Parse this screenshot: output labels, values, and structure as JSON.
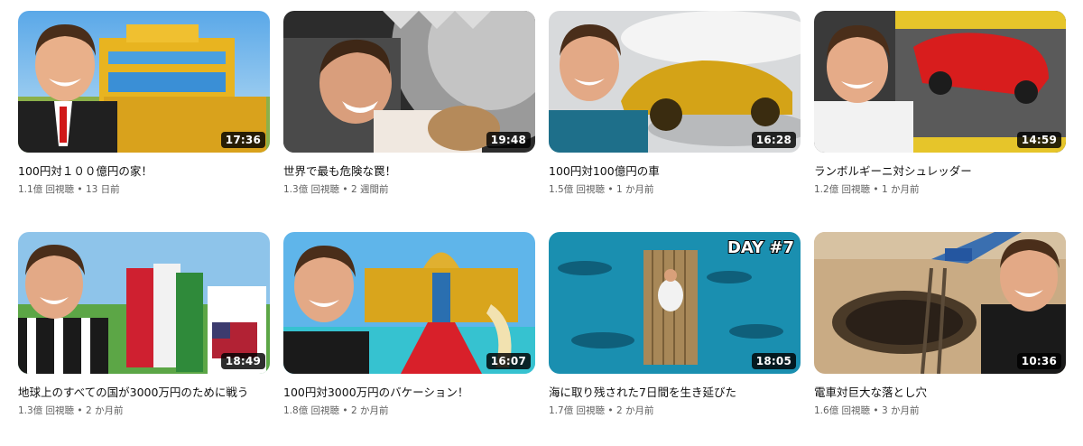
{
  "videos": [
    {
      "title": "100円対１００億円の家！",
      "views": "1.1億 回視聴",
      "age": "13 日前",
      "duration": "17:36"
    },
    {
      "title": "世界で最も危険な罠！",
      "views": "1.3億 回視聴",
      "age": "2 週間前",
      "duration": "19:48"
    },
    {
      "title": "100円対100億円の車",
      "views": "1.5億 回視聴",
      "age": "1 か月前",
      "duration": "16:28"
    },
    {
      "title": "ランボルギーニ対シュレッダー",
      "views": "1.2億 回視聴",
      "age": "1 か月前",
      "duration": "14:59"
    },
    {
      "title": "地球上のすべての国が3000万円のために戦う",
      "views": "1.3億 回視聴",
      "age": "2 か月前",
      "duration": "18:49"
    },
    {
      "title": "100円対3000万円のバケーション！",
      "views": "1.8億 回視聴",
      "age": "2 か月前",
      "duration": "16:07"
    },
    {
      "title": "海に取り残された7日間を生き延びた",
      "views": "1.7億 回視聴",
      "age": "2 か月前",
      "duration": "18:05"
    },
    {
      "title": "電車対巨大な落とし穴",
      "views": "1.6億 回視聴",
      "age": "3 か月前",
      "duration": "10:36"
    }
  ],
  "thumb_texts": {
    "day_label": "DAY #7"
  },
  "separator": "•"
}
